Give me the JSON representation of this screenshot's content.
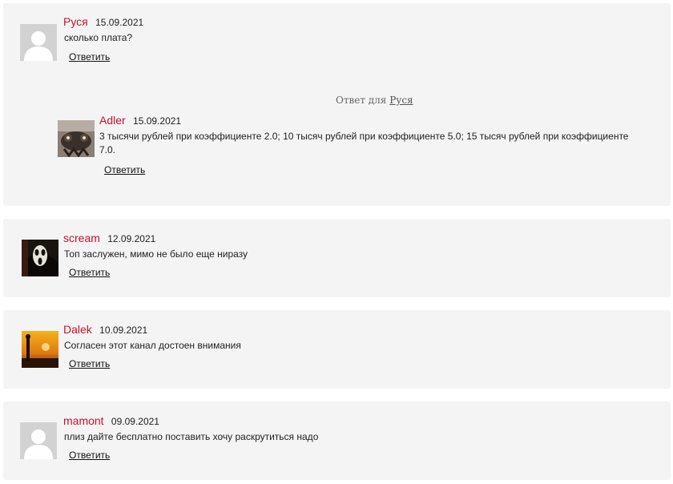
{
  "comments": [
    {
      "author": "Руся",
      "date": "15.09.2021",
      "text": "сколько плата?",
      "reply_label": "Ответить",
      "avatar": "default-avatar-icon",
      "reply_to_prefix": "Ответ для",
      "reply_to_name": "Руся",
      "child": {
        "author": "Adler",
        "date": "15.09.2021",
        "text": "3 тысячи рублей при коэффициенте 2.0; 10 тысяч рублей при коэффициенте 5.0; 15 тысяч рублей при коэффициенте 7.0.",
        "reply_label": "Ответить",
        "avatar": "animal-photo-avatar"
      }
    },
    {
      "author": "scream",
      "date": "12.09.2021",
      "text": "Топ заслужен, мимо не было еще ниразу",
      "reply_label": "Ответить",
      "avatar": "scream-mask-avatar"
    },
    {
      "author": "Dalek",
      "date": "10.09.2021",
      "text": "Согласен этот канал достоен внимания",
      "reply_label": "Ответить",
      "avatar": "sunset-photo-avatar"
    },
    {
      "author": "mamont",
      "date": "09.09.2021",
      "text": "плиз дайте бесплатно поставить хочу раскрутиться надо",
      "reply_label": "Ответить",
      "avatar": "default-avatar-icon"
    }
  ],
  "colors": {
    "author": "#c8102e",
    "card_background": "#f4f4f4"
  }
}
